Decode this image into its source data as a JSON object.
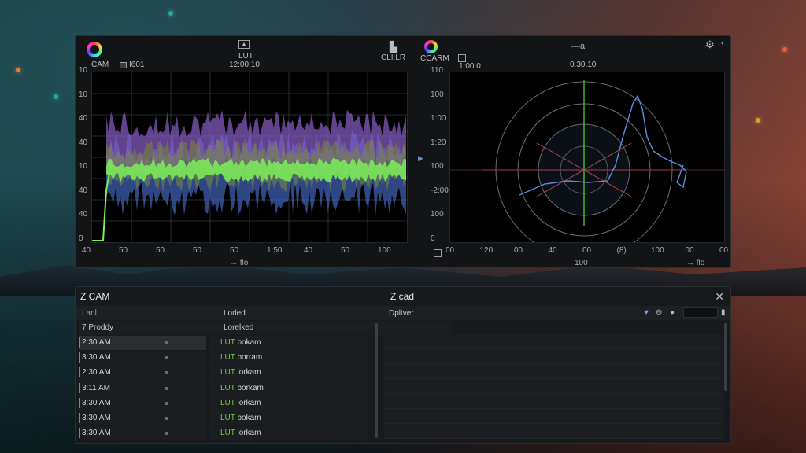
{
  "scopes": {
    "left": {
      "logo_label": "CAM",
      "meta_label": "I601",
      "center_title": "LUT",
      "center_sub": "12:00:10",
      "right_label": "CLI:LR",
      "y_labels": [
        "10",
        "10",
        "40",
        "40",
        "10",
        "40",
        "40",
        "0"
      ],
      "x_labels": [
        "40",
        "50",
        "50",
        "50",
        "50",
        "1:50",
        "40",
        "50",
        "100"
      ],
      "x_unit": "→ flo"
    },
    "right": {
      "logo_label": "CCARM",
      "checkbox_label": "1:00.0",
      "center_title": "—a",
      "center_sub": "0.30.10",
      "y_labels": [
        "110",
        "100",
        "1:00",
        "1:20",
        "100",
        "-2:00",
        "100",
        "0"
      ],
      "x_labels": [
        "00",
        "120",
        "00",
        "40",
        "00",
        "(8)",
        "100",
        "00",
        "00"
      ],
      "x_sub": "100",
      "x_unit": "→ flo"
    }
  },
  "list": {
    "title": "Z CAM",
    "center_title": "Z cad",
    "col_left": "Lanl",
    "col_mid": "Lorled",
    "col_right": "Dpltver",
    "sub_left": "7 Proddy",
    "sub_mid": "Lorelked",
    "rows": [
      {
        "time": "2:30 AM",
        "lut_tag": "LUT",
        "lut_name": "bokam"
      },
      {
        "time": "3:30 AM",
        "lut_tag": "LUT",
        "lut_name": "borram"
      },
      {
        "time": "2:30 AM",
        "lut_tag": "LUT",
        "lut_name": "lorkam"
      },
      {
        "time": "3:11 AM",
        "lut_tag": "LUT",
        "lut_name": "borkam"
      },
      {
        "time": "3:30 AM",
        "lut_tag": "LUT",
        "lut_name": "lorkam"
      },
      {
        "time": "3:30 AM",
        "lut_tag": "LUT",
        "lut_name": "bokam"
      },
      {
        "time": "3:30 AM",
        "lut_tag": "LUT",
        "lut_name": "lorkam"
      }
    ]
  },
  "icons": {
    "logo": "color-wheel-icon",
    "settings": "gear-icon",
    "collapse": "chevron-left-icon",
    "close": "close-icon",
    "favorite": "heart-icon"
  },
  "colors": {
    "accent_green": "#6fcf3f",
    "waveform_green": "#7cf05a",
    "waveform_purple": "#8a5ec9",
    "waveform_blue": "#3d5fb0",
    "vectorscope_line": "#5a8fe0"
  }
}
